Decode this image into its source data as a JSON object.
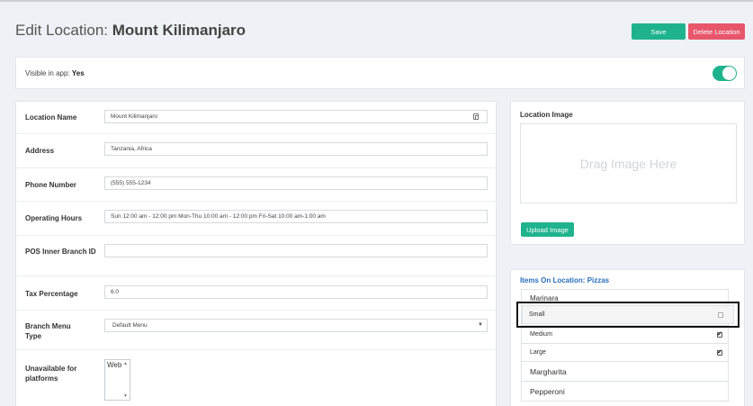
{
  "header": {
    "title_prefix": "Edit Location: ",
    "title_name": "Mount Kilimanjaro",
    "save_label": "Save",
    "delete_label": "Delete Location"
  },
  "visibility": {
    "label": "Visible in app: ",
    "value": "Yes",
    "toggle_on": true
  },
  "form": {
    "location_name": {
      "label": "Location Name",
      "value": "Mount Kilimanjaro"
    },
    "address": {
      "label": "Address",
      "value": "Tanzania, Africa"
    },
    "phone": {
      "label": "Phone Number",
      "value": "(555) 555-1234"
    },
    "hours": {
      "label": "Operating Hours",
      "value": "Sun 12:00 am - 12:00 pm Mon-Thu 10:00 am - 12:00 pm Fri-Sat 10:00 am-1:00 am"
    },
    "pos_id": {
      "label": "POS Inner Branch ID",
      "value": ""
    },
    "tax": {
      "label": "Tax Percentage",
      "value": "6.0"
    },
    "branch_menu": {
      "label": "Branch Menu Type",
      "value": "Default Menu"
    },
    "unavailable": {
      "label": "Unavailable for platforms",
      "option": "Web"
    }
  },
  "image_panel": {
    "title": "Location Image",
    "dropzone_text": "Drag Image Here",
    "upload_label": "Upload Image"
  },
  "items_panel": {
    "title": "Items On Location: Pizzas",
    "items": [
      {
        "label": "Marinara",
        "has_checkbox": false
      },
      {
        "label": "Small",
        "has_checkbox": true,
        "checked": false
      },
      {
        "label": "Medium",
        "has_checkbox": true,
        "checked": true
      },
      {
        "label": "Large",
        "has_checkbox": true,
        "checked": true
      },
      {
        "label": "Margharita",
        "has_checkbox": false
      },
      {
        "label": "Pepperoni",
        "has_checkbox": false
      }
    ]
  },
  "colors": {
    "accent_green": "#1fb38d",
    "delete_red": "#e8566c",
    "link_blue": "#2a6ebd",
    "background": "#eef1f5"
  }
}
